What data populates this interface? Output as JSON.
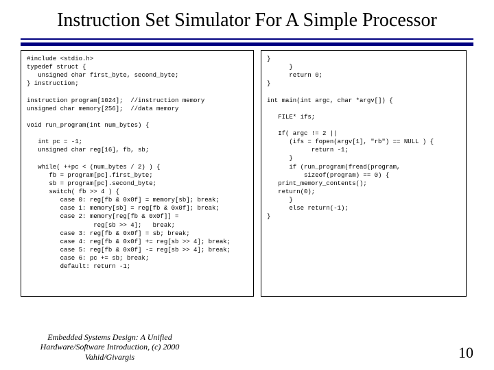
{
  "title": "Instruction Set Simulator For A Simple Processor",
  "code_left": "#include <stdio.h>\ntypedef struct {\n   unsigned char first_byte, second_byte;\n} instruction;\n\ninstruction program[1024];  //instruction memory\nunsigned char memory[256];  //data memory\n\nvoid run_program(int num_bytes) {\n\n   int pc = -1;\n   unsigned char reg[16], fb, sb;\n\n   while( ++pc < (num_bytes / 2) ) {\n      fb = program[pc].first_byte;\n      sb = program[pc].second_byte;\n      switch( fb >> 4 ) {\n         case 0: reg[fb & 0x0f] = memory[sb]; break;\n         case 1: memory[sb] = reg[fb & 0x0f]; break;\n         case 2: memory[reg[fb & 0x0f]] =\n                  reg[sb >> 4];   break;\n         case 3: reg[fb & 0x0f] = sb; break;\n         case 4: reg[fb & 0x0f] += reg[sb >> 4]; break;\n         case 5: reg[fb & 0x0f] -= reg[sb >> 4]; break;\n         case 6: pc += sb; break;\n         default: return -1;\n",
  "code_right": "}\n      }\n      return 0;\n}\n\nint main(int argc, char *argv[]) {\n\n   FILE* ifs;\n\n   If( argc != 2 ||\n      (ifs = fopen(argv[1], \"rb\") == NULL ) {\n            return -1;\n      }\n      if (run_program(fread(program,\n          sizeof(program) == 0) {\n   print_memory_contents();\n   return(0);\n      }\n      else return(-1);\n}",
  "footer_text": "Embedded Systems Design: A Unified Hardware/Software Introduction, (c) 2000 Vahid/Givargis",
  "page_number": "10"
}
